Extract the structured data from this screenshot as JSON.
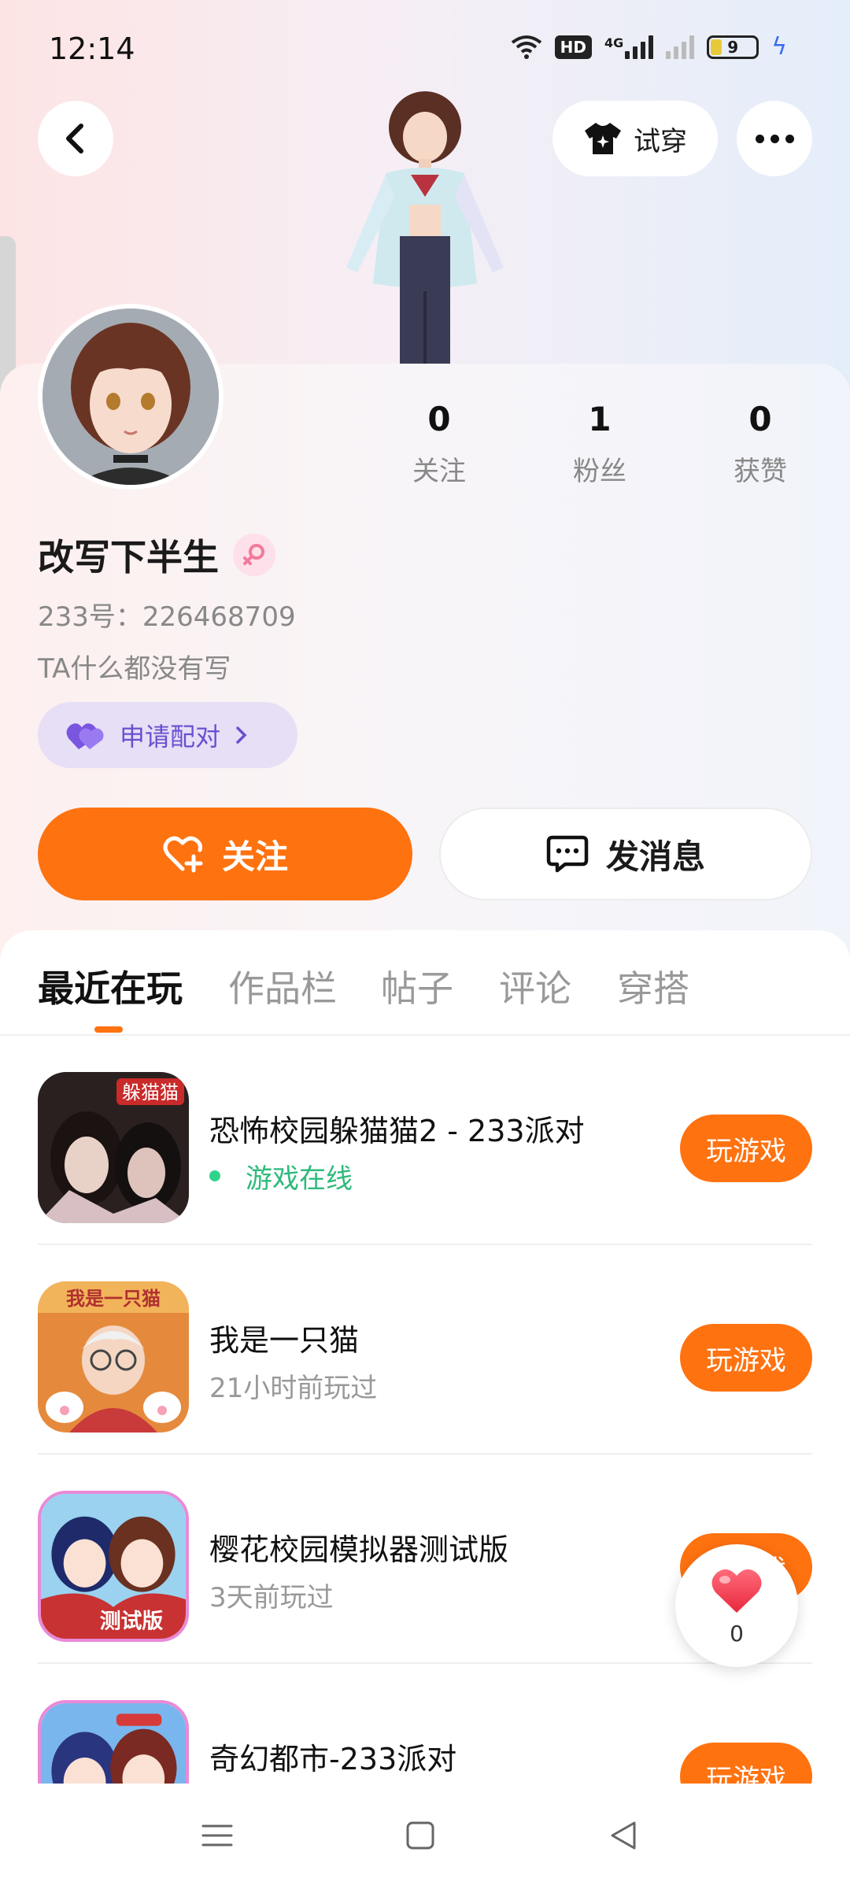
{
  "status_bar": {
    "time": "12:14",
    "network": "4G",
    "hd": "HD",
    "battery": "9",
    "icons": [
      "wifi-icon",
      "hd-icon",
      "signal-icon",
      "signal-icon",
      "battery-icon",
      "charging-icon"
    ]
  },
  "header": {
    "back_icon": "back-arrow-icon",
    "try_on_label": "试穿",
    "try_on_icon": "tshirt-icon",
    "more_icon": "more-icon"
  },
  "profile": {
    "name": "改写下半生",
    "gender_icon": "female-icon",
    "id_text": "233号：226468709",
    "bio": "TA什么都没有写",
    "pair_label": "申请配对",
    "stats": [
      {
        "value": "0",
        "label": "关注"
      },
      {
        "value": "1",
        "label": "粉丝"
      },
      {
        "value": "0",
        "label": "获赞"
      }
    ]
  },
  "actions": {
    "follow_label": "关注",
    "message_label": "发消息"
  },
  "tabs": [
    {
      "label": "最近在玩",
      "active": true
    },
    {
      "label": "作品栏",
      "active": false
    },
    {
      "label": "帖子",
      "active": false
    },
    {
      "label": "评论",
      "active": false
    },
    {
      "label": "穿搭",
      "active": false
    }
  ],
  "games": [
    {
      "title": "恐怖校园躲猫猫2 - 233派对",
      "status": "游戏在线",
      "online": true,
      "button": "玩游戏",
      "icon_text": "躲猫猫"
    },
    {
      "title": "我是一只猫",
      "status": "21小时前玩过",
      "online": false,
      "button": "玩游戏",
      "icon_text": "我是一只猫"
    },
    {
      "title": "樱花校园模拟器测试版",
      "status": "3天前玩过",
      "online": false,
      "button": "玩游戏",
      "icon_text": "测试版"
    },
    {
      "title": "奇幻都市-233派对",
      "status": "",
      "online": false,
      "button": "玩游戏",
      "icon_text": ""
    }
  ],
  "fab": {
    "count": "0",
    "icon": "heart-icon"
  },
  "colors": {
    "accent": "#ff7210",
    "online": "#2fba7c",
    "pair": "#6b4fd0"
  }
}
